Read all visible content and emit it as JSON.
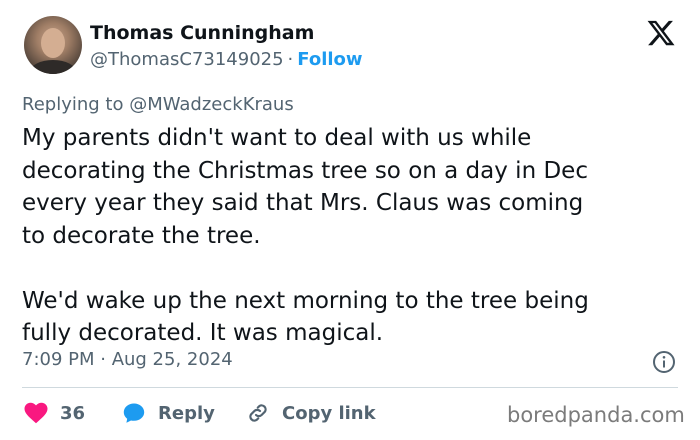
{
  "author": {
    "name": "Thomas Cunningham",
    "handle": "@ThomasC73149025",
    "separator": "·",
    "follow_label": "Follow"
  },
  "reply_context": {
    "prefix": "Replying to",
    "mention": "@MWadzeckKraus"
  },
  "tweet": {
    "text": "My parents didn't want to deal with us while\ndecorating the Christmas tree so on a day in Dec\nevery year they said that Mrs. Claus was coming\nto decorate the tree.\n\nWe'd wake up the next morning to the tree being\nfully decorated. It was magical.",
    "timestamp": "7:09 PM · Aug 25, 2024"
  },
  "actions": {
    "like_count": "36",
    "reply_label": "Reply",
    "copy_link_label": "Copy link"
  },
  "watermark": "boredpanda.com",
  "colors": {
    "link_blue": "#1d9bf0",
    "like_red": "#f91880",
    "text_primary": "#0f1419",
    "text_secondary": "#536471",
    "divider": "#cfd9de"
  },
  "icons": [
    "x-logo-icon",
    "info-icon",
    "heart-icon",
    "reply-bubble-icon",
    "link-icon"
  ]
}
